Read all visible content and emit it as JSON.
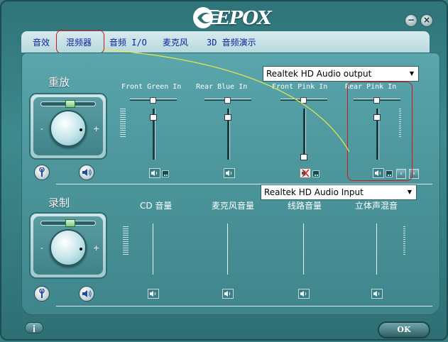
{
  "window": {
    "logo_text": "EPOX",
    "minimize_glyph": "−",
    "close_glyph": "×"
  },
  "tabs": [
    {
      "label": "音效"
    },
    {
      "label": "混频器",
      "selected": true
    },
    {
      "label": "音频 I/O"
    },
    {
      "label": "麦克风"
    },
    {
      "label": "3D 音频演示"
    }
  ],
  "playback": {
    "title": "重放",
    "device": "Realtek HD Audio output",
    "minus": "-",
    "plus": "+",
    "channels": [
      {
        "label": "Front Green In",
        "level": 0.88,
        "muted": false,
        "selector": true
      },
      {
        "label": "Rear Blue In",
        "level": 0.88,
        "muted": false,
        "selector": false
      },
      {
        "label": "Front Pink In",
        "level": 0.0,
        "muted": true,
        "selector": true
      },
      {
        "label": "Rear Pink In",
        "level": 0.88,
        "muted": false,
        "selector": true
      }
    ]
  },
  "recording": {
    "title": "录制",
    "device": "Realtek HD Audio Input",
    "minus": "-",
    "plus": "+",
    "channels": [
      {
        "label": "CD 音量"
      },
      {
        "label": "麦克风音量"
      },
      {
        "label": "线路音量"
      },
      {
        "label": "立体声混音"
      }
    ]
  },
  "footer": {
    "ok_label": "OK"
  },
  "colors": {
    "tab_text": "#0b1f9b",
    "highlight": "#d01818",
    "annotation_line": "#e8e84a"
  }
}
